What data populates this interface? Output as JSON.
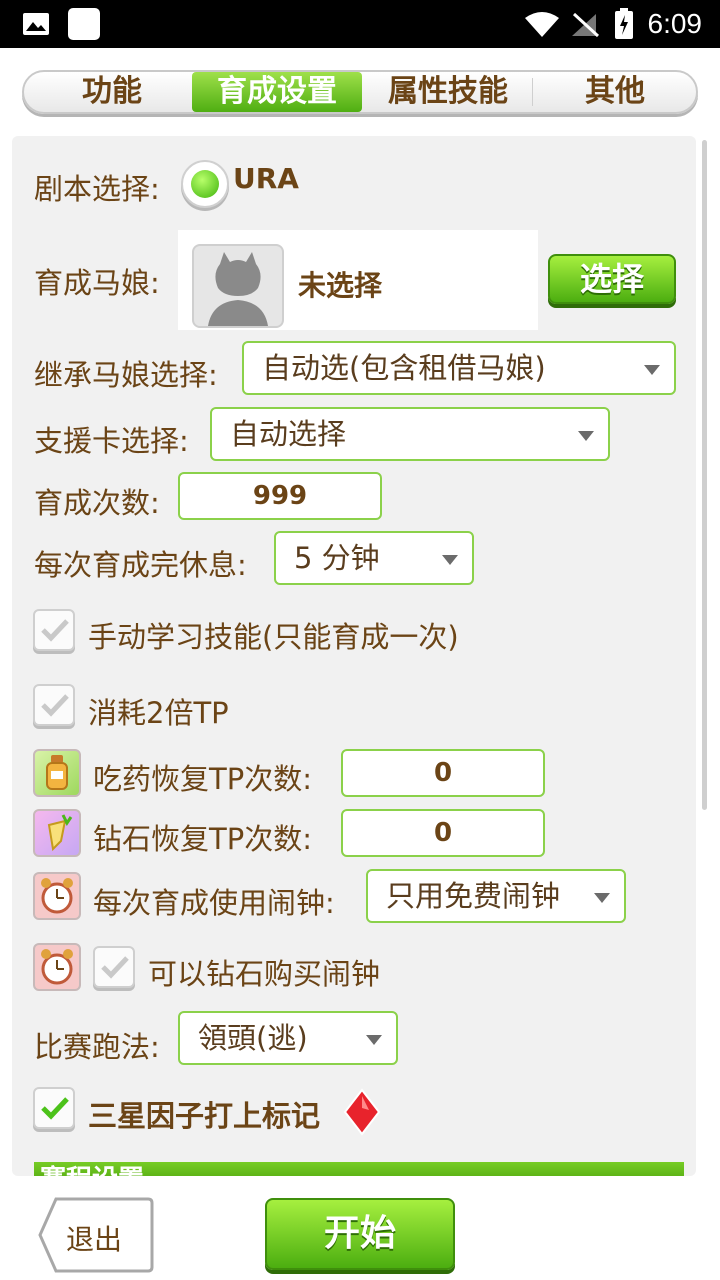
{
  "status_bar": {
    "time": "6:09"
  },
  "tabs": [
    {
      "label": "功能",
      "active": false
    },
    {
      "label": "育成设置",
      "active": true
    },
    {
      "label": "属性技能",
      "active": false
    },
    {
      "label": "其他",
      "active": false
    }
  ],
  "scenario": {
    "label": "剧本选择:",
    "value": "URA"
  },
  "trainee": {
    "label": "育成马娘:",
    "status": "未选择",
    "select_button": "选择"
  },
  "inherit": {
    "label": "继承马娘选择:",
    "value": "自动选(包含租借马娘)"
  },
  "support": {
    "label": "支援卡选择:",
    "value": "自动选择"
  },
  "count": {
    "label": "育成次数:",
    "value": "999"
  },
  "rest": {
    "label": "每次育成完休息:",
    "value": "5 分钟"
  },
  "manual_skill": {
    "label": "手动学习技能(只能育成一次)",
    "checked": true
  },
  "double_tp": {
    "label": "消耗2倍TP",
    "checked": true
  },
  "medicine_tp": {
    "label": "吃药恢复TP次数:",
    "value": "0"
  },
  "diamond_tp": {
    "label": "钻石恢复TP次数:",
    "value": "0"
  },
  "alarm": {
    "label": "每次育成使用闹钟:",
    "value": "只用免费闹钟"
  },
  "buy_alarm": {
    "label": "可以钻石购买闹钟",
    "checked": true
  },
  "run_style": {
    "label": "比赛跑法:",
    "value": "領頭(逃)"
  },
  "three_star": {
    "label": "三星因子打上标记",
    "checked": true
  },
  "section_next": {
    "label": "赛程设置"
  },
  "footer": {
    "exit": "退出",
    "start": "开始"
  },
  "colors": {
    "accent_green": "#5fb81a",
    "text_brown": "#6b4416"
  }
}
